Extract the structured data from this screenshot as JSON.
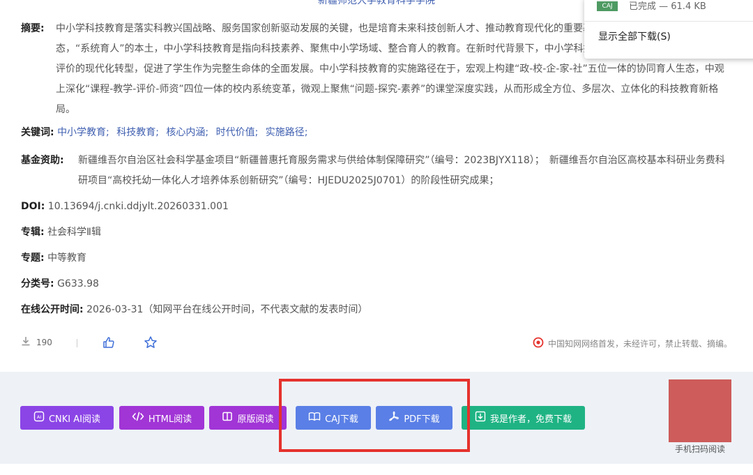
{
  "header": {
    "affiliation": "新疆师范大学教育科学学院"
  },
  "abstract": {
    "label": "摘要:",
    "text": "中小学科技教育是落实科教兴国战略、服务国家创新驱动发展的关键，也是培育未来科技创新人才、推动教育现代化的重要基础。作为一种人才培养的新生态，“系统育人”的本土，中小学科技教育是指向科技素养、聚焦中小学场域、整合育人的教育。在新时代背景下，中小学科技教育奠定了科技课程、教学与评价的现代化转型，促进了学生作为完整生命体的全面发展。中小学科技教育的实施路径在于，宏观上构建“政-校-企-家-社”五位一体的协同育人生态，中观上深化“课程-教学-评价-师资”四位一体的校内系统变革，微观上聚焦“问题-探究-素养”的课堂深度实践，从而形成全方位、多层次、立体化的科技教育新格局。"
  },
  "keywords": {
    "label": "关键词:",
    "items": [
      "中小学教育;",
      "科技教育;",
      "核心内涵;",
      "时代价值;",
      "实施路径;"
    ]
  },
  "fund": {
    "label": "基金资助:",
    "text": "新疆维吾尔自治区社会科学基金项目“新疆普惠托育服务需求与供给体制保障研究”（编号：2023BJYX118）；　新疆维吾尔自治区高校基本科研业务费科研项目“高校托幼一体化人才培养体系创新研究”（编号：HJEDU2025J0701）的阶段性研究成果；"
  },
  "doi": {
    "label": "DOI:",
    "value": "10.13694/j.cnki.ddjylt.20260331.001"
  },
  "series": {
    "label": "专辑:",
    "value": "社会科学Ⅱ辑"
  },
  "topic": {
    "label": "专题:",
    "value": "中等教育"
  },
  "classno": {
    "label": "分类号:",
    "value": "G633.98"
  },
  "pubtime": {
    "label": "在线公开时间:",
    "value": "2026-03-31（知网平台在线公开时间，不代表文献的发表时间）"
  },
  "stats": {
    "downloads": "190",
    "notice": "中国知网网络首发，未经许可，禁止转载、摘编。"
  },
  "actions": {
    "cnki_ai": "CNKI AI阅读",
    "html_read": "HTML阅读",
    "original_read": "原版阅读",
    "caj_download": "CAJ下载",
    "pdf_download": "PDF下载",
    "author_download": "我是作者，免费下载"
  },
  "qr": {
    "label": "手机扫码阅读"
  },
  "download_popup": {
    "file_type": "CAJ",
    "status": "已完成 — 61.4 KB",
    "show_all": "显示全部下载(S)"
  },
  "colors": {
    "purple": "#8b45e6",
    "magenta": "#a135d6",
    "blue": "#5a7fe6",
    "green": "#1fb383",
    "highlight": "#e5322d"
  }
}
